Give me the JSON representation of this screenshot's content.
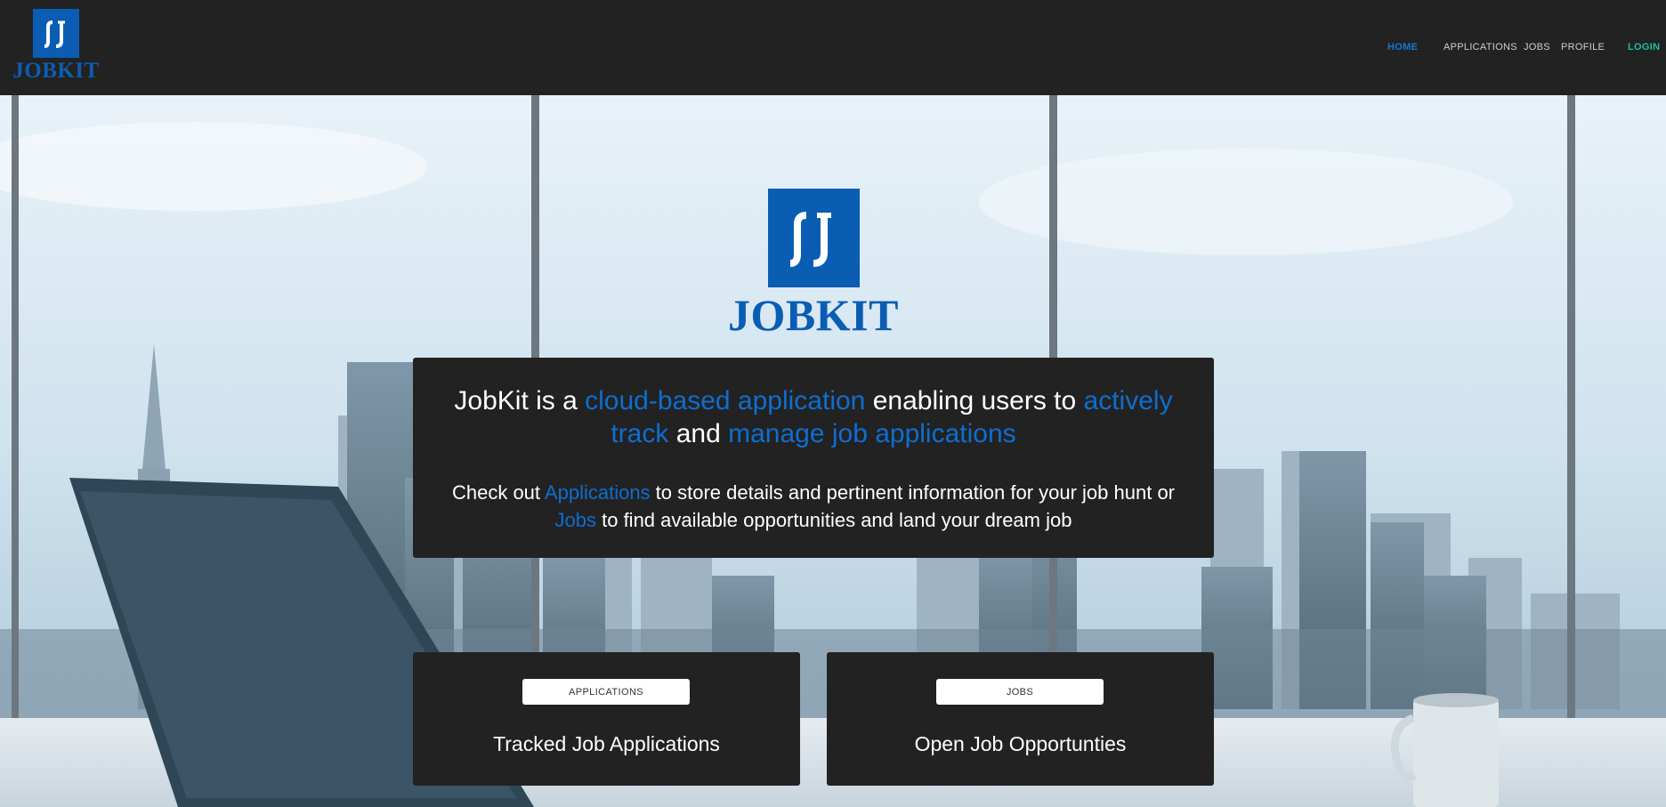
{
  "brand": {
    "name": "JOBKIT",
    "mark": "ʃJ",
    "logo_color": "#0b5db3"
  },
  "nav": {
    "links": [
      {
        "label": "HOME",
        "active": true
      },
      {
        "label": "APPLICATIONS",
        "active": false
      },
      {
        "label": "JOBS",
        "active": false
      },
      {
        "label": "PROFILE",
        "active": false
      }
    ],
    "login": "LOGIN"
  },
  "hero": {
    "headline": {
      "p1": "JobKit is a ",
      "hl1": "cloud-based application",
      "p2": " enabling users to ",
      "hl2": "actively track",
      "p3": " and ",
      "hl3": "manage job applications"
    },
    "subline": {
      "p1": "Check out ",
      "hl1": "Applications",
      "p2": " to store details and pertinent information for your job hunt or ",
      "hl2": "Jobs",
      "p3": " to find available opportunities and land your dream job"
    }
  },
  "cards": [
    {
      "button": "APPLICATIONS",
      "title": "Tracked Job Applications"
    },
    {
      "button": "JOBS",
      "title": "Open Job Opportunties"
    }
  ],
  "colors": {
    "navbar_bg": "#222222",
    "panel_bg": "#222222",
    "accent": "#0e6ed0",
    "active_nav": "#1279d6",
    "login": "#16c0a0"
  }
}
